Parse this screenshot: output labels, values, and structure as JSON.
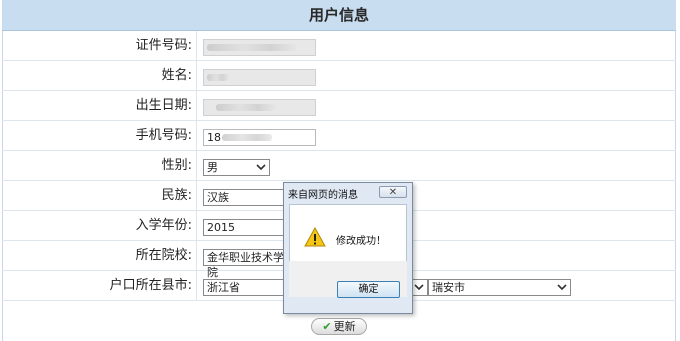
{
  "header": {
    "title": "用户信息"
  },
  "form": {
    "id_label": "证件号码:",
    "name_label": "姓名:",
    "birth_label": "出生日期:",
    "phone_label": "手机号码:",
    "phone_value": "18",
    "gender_label": "性别:",
    "gender_value": "男",
    "ethnicity_label": "民族:",
    "ethnicity_value": "汉族",
    "enroll_year_label": "入学年份:",
    "enroll_year_value": "2015",
    "school_label": "所在院校:",
    "school_value": "金华职业技术学院",
    "hukou_label": "户口所在县市:",
    "province_value": "浙江省",
    "city_value": "瑞安市",
    "update_label": "更新"
  },
  "dialog": {
    "title": "来自网页的消息",
    "message": "修改成功！",
    "ok_label": "确定",
    "close_glyph": "✕"
  },
  "icons": {
    "warning": "warning-icon",
    "update_check": "check-icon",
    "dropdown": "chevron-down-icon"
  }
}
